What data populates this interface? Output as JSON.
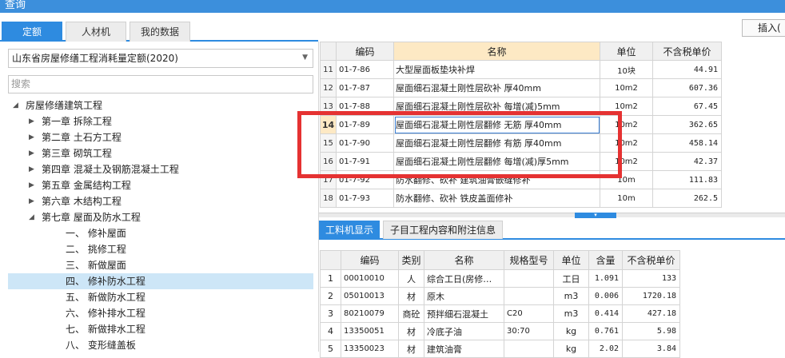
{
  "window": {
    "title": "查询"
  },
  "left_tabs": [
    "定额",
    "人材机",
    "我的数据"
  ],
  "library_select": {
    "value": "山东省房屋修缮工程消耗量定额(2020)"
  },
  "search": {
    "placeholder": "搜索"
  },
  "tree": [
    {
      "label": "房屋修缮建筑工程",
      "level": 0,
      "expanded": true
    },
    {
      "label": "第一章 拆除工程",
      "level": 1,
      "expanded": false
    },
    {
      "label": "第二章 土石方工程",
      "level": 1,
      "expanded": false
    },
    {
      "label": "第三章 砌筑工程",
      "level": 1,
      "expanded": false
    },
    {
      "label": "第四章 混凝土及钢筋混凝土工程",
      "level": 1,
      "expanded": false
    },
    {
      "label": "第五章 金属结构工程",
      "level": 1,
      "expanded": false
    },
    {
      "label": "第六章 木结构工程",
      "level": 1,
      "expanded": false
    },
    {
      "label": "第七章 屋面及防水工程",
      "level": 1,
      "expanded": true
    },
    {
      "label": "一、 修补屋面",
      "level": 2
    },
    {
      "label": "二、 挑修工程",
      "level": 2
    },
    {
      "label": "三、 新做屋面",
      "level": 2
    },
    {
      "label": "四、 修补防水工程",
      "level": 2,
      "selected": true
    },
    {
      "label": "五、 新做防水工程",
      "level": 2
    },
    {
      "label": "六、 修补排水工程",
      "level": 2
    },
    {
      "label": "七、 新做排水工程",
      "level": 2
    },
    {
      "label": "八、 变形缝盖板",
      "level": 2
    }
  ],
  "toolbar": {
    "insert_label": "插入("
  },
  "quota_table": {
    "headers": [
      "",
      "编码",
      "名称",
      "单位",
      "不含税单价"
    ],
    "rows": [
      {
        "no": "11",
        "code": "01-7-86",
        "name": "大型屋面板垫块补焊",
        "unit": "10块",
        "price": "44.91"
      },
      {
        "no": "12",
        "code": "01-7-87",
        "name": "屋面细石混凝土刚性层砍补 厚40mm",
        "unit": "10m2",
        "price": "607.36"
      },
      {
        "no": "13",
        "code": "01-7-88",
        "name": "屋面细石混凝土刚性层砍补 每增(减)5mm",
        "unit": "10m2",
        "price": "67.45"
      },
      {
        "no": "14",
        "code": "01-7-89",
        "name": "屋面细石混凝土刚性层翻修 无筋 厚40mm",
        "unit": "10m2",
        "price": "362.65",
        "current": true
      },
      {
        "no": "15",
        "code": "01-7-90",
        "name": "屋面细石混凝土刚性层翻修 有筋 厚40mm",
        "unit": "10m2",
        "price": "458.14"
      },
      {
        "no": "16",
        "code": "01-7-91",
        "name": "屋面细石混凝土刚性层翻修 每增(减)厚5mm",
        "unit": "10m2",
        "price": "42.37"
      },
      {
        "no": "17",
        "code": "01-7-92",
        "name": "防水翻修、砍补 建筑油膏嵌缝修补",
        "unit": "10m",
        "price": "111.83"
      },
      {
        "no": "18",
        "code": "01-7-93",
        "name": "防水翻修、砍补 铁皮盖面修补",
        "unit": "10m",
        "price": "262.5"
      }
    ]
  },
  "sub_tabs": [
    "工料机显示",
    "子目工程内容和附注信息"
  ],
  "material_table": {
    "headers": [
      "",
      "编码",
      "类别",
      "名称",
      "规格型号",
      "单位",
      "含量",
      "不含税单价"
    ],
    "rows": [
      {
        "no": "1",
        "code": "00010010",
        "type": "人",
        "name": "综合工日(房修…",
        "spec": "",
        "unit": "工日",
        "qty": "1.091",
        "price": "133"
      },
      {
        "no": "2",
        "code": "05010013",
        "type": "材",
        "name": "原木",
        "spec": "",
        "unit": "m3",
        "qty": "0.006",
        "price": "1720.18"
      },
      {
        "no": "3",
        "code": "80210079",
        "type": "商砼",
        "name": "预拌细石混凝土",
        "spec": "C20",
        "unit": "m3",
        "qty": "0.414",
        "price": "427.18"
      },
      {
        "no": "4",
        "code": "13350051",
        "type": "材",
        "name": "冷底子油",
        "spec": "30:70",
        "unit": "kg",
        "qty": "0.761",
        "price": "5.98"
      },
      {
        "no": "5",
        "code": "13350023",
        "type": "材",
        "name": "建筑油膏",
        "spec": "",
        "unit": "kg",
        "qty": "2.02",
        "price": "3.84"
      }
    ]
  },
  "colors": {
    "accent": "#2e8be0",
    "highlight_box": "#e53232",
    "selected_row": "#cde6f7",
    "current_cell": "#fde9c4"
  }
}
